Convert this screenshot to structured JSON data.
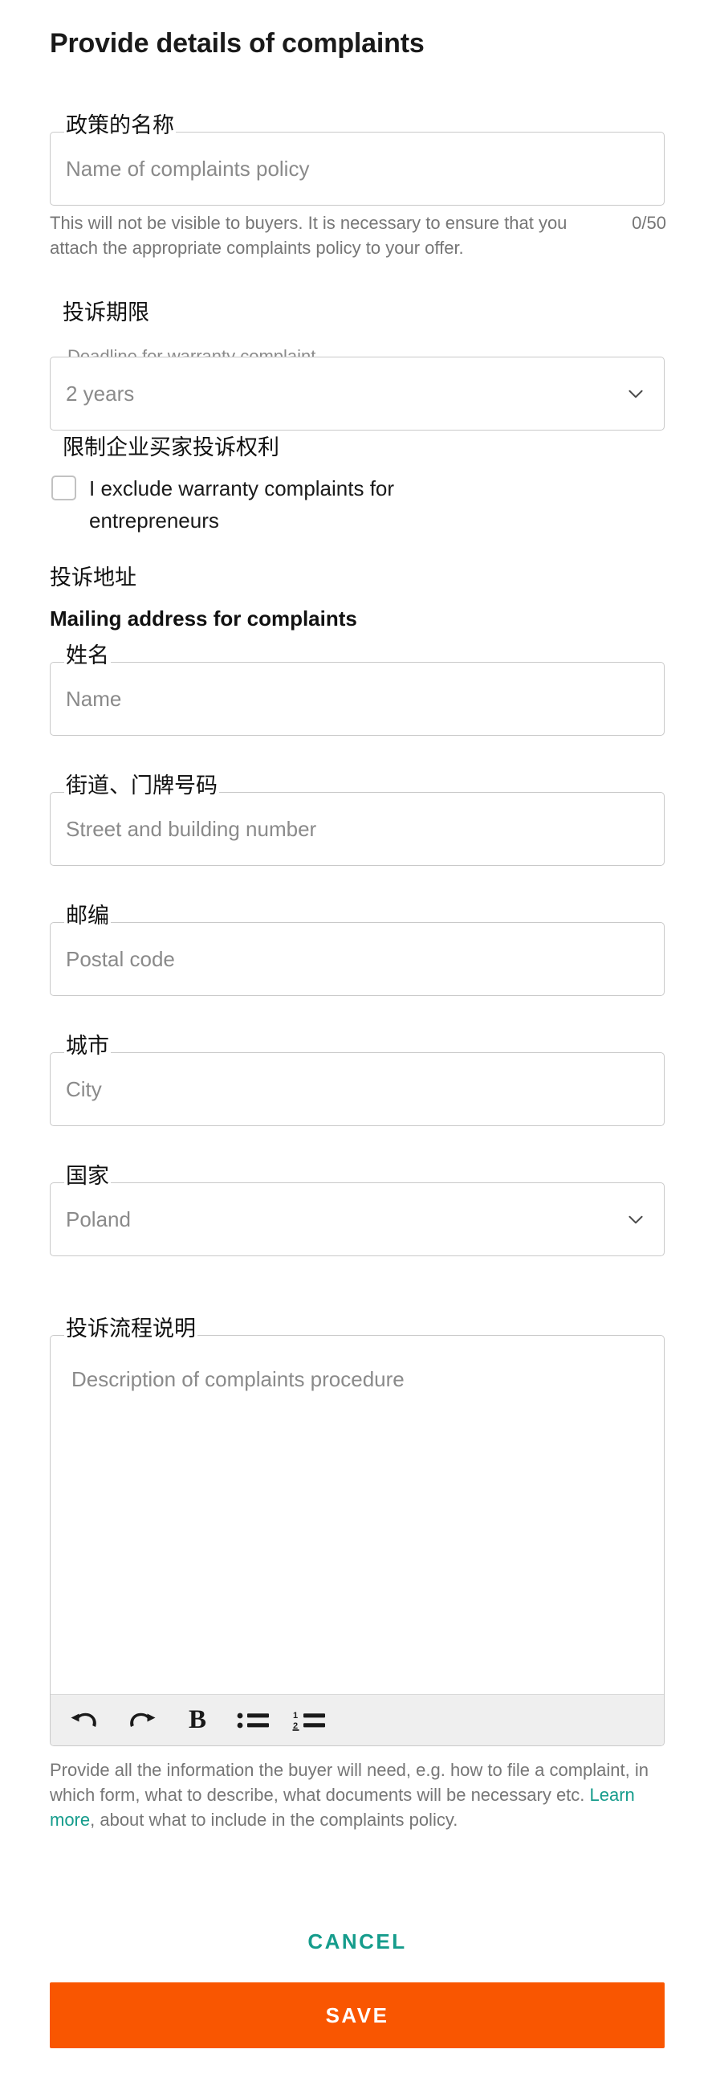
{
  "page": {
    "title": "Provide details of complaints"
  },
  "policy_name": {
    "cn_label": "政策的名称",
    "placeholder": "Name of complaints policy",
    "helper": "This will not be visible to buyers. It is necessary to ensure that you attach the appropriate complaints policy to your offer.",
    "counter": "0/50",
    "value": ""
  },
  "deadline": {
    "cn_heading": "投诉期限",
    "legend": "Deadline for warranty complaint",
    "value": "2 years",
    "chevron_icon": "chevron-down-icon"
  },
  "exclude": {
    "cn_heading": "限制企业买家投诉权利",
    "checkbox_label": "I exclude warranty complaints for entrepreneurs",
    "checked": false
  },
  "address": {
    "cn_heading": "投诉地址",
    "heading": "Mailing address for complaints",
    "fields": [
      {
        "cn_label": "姓名",
        "placeholder": "Name",
        "value": "",
        "type": "text"
      },
      {
        "cn_label": "街道、门牌号码",
        "placeholder": "Street and building number",
        "value": "",
        "type": "text"
      },
      {
        "cn_label": "邮编",
        "placeholder": "Postal code",
        "value": "",
        "type": "text"
      },
      {
        "cn_label": "城市",
        "placeholder": "City",
        "value": "",
        "type": "text"
      },
      {
        "cn_label": "国家",
        "placeholder": "Poland",
        "value": "Poland",
        "type": "select"
      }
    ]
  },
  "procedure": {
    "cn_label": "投诉流程说明",
    "placeholder": "Description of complaints procedure",
    "value": "",
    "toolbar": [
      {
        "name": "undo-icon",
        "label": "Undo"
      },
      {
        "name": "redo-icon",
        "label": "Redo"
      },
      {
        "name": "bold-icon",
        "label": "B"
      },
      {
        "name": "bulleted-list-icon",
        "label": "Bulleted list"
      },
      {
        "name": "numbered-list-icon",
        "label": "Numbered list"
      }
    ],
    "note_before_link": "Provide all the information the buyer will need, e.g. how to file a complaint, in which form, what to describe, what documents will be necessary etc. ",
    "note_link": "Learn more",
    "note_after_link": ", about what to include in the complaints policy."
  },
  "actions": {
    "cancel_label": "CANCEL",
    "save_label": "SAVE"
  },
  "colors": {
    "accent_teal": "#159c8c",
    "accent_orange": "#f95601",
    "border_gray": "#c9c9c9",
    "text_muted": "#767676",
    "text_dark": "#1a1a1a",
    "toolbar_bg": "#efefef"
  }
}
